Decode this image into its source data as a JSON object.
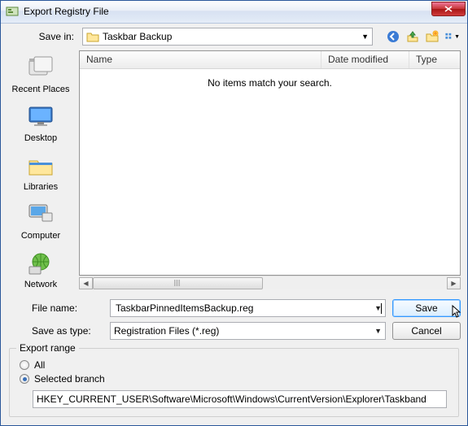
{
  "title": "Export Registry File",
  "toolbar": {
    "save_in_label": "Save in:",
    "save_in_value": "Taskbar Backup",
    "icons": {
      "back": "back-icon",
      "up": "up-icon",
      "newfolder": "new-folder-icon",
      "views": "views-icon"
    }
  },
  "places": [
    {
      "label": "Recent Places"
    },
    {
      "label": "Desktop"
    },
    {
      "label": "Libraries"
    },
    {
      "label": "Computer"
    },
    {
      "label": "Network"
    }
  ],
  "columns": {
    "name": "Name",
    "date": "Date modified",
    "type": "Type"
  },
  "empty_message": "No items match your search.",
  "form": {
    "filename_label": "File name:",
    "filename_value": "TaskbarPinnedItemsBackup.reg",
    "savetype_label": "Save as type:",
    "savetype_value": "Registration Files (*.reg)",
    "save_button": "Save",
    "cancel_button": "Cancel"
  },
  "export": {
    "legend": "Export range",
    "all_label": "All",
    "selected_label": "Selected branch",
    "selected_checked": true,
    "branch_value": "HKEY_CURRENT_USER\\Software\\Microsoft\\Windows\\CurrentVersion\\Explorer\\Taskband"
  }
}
